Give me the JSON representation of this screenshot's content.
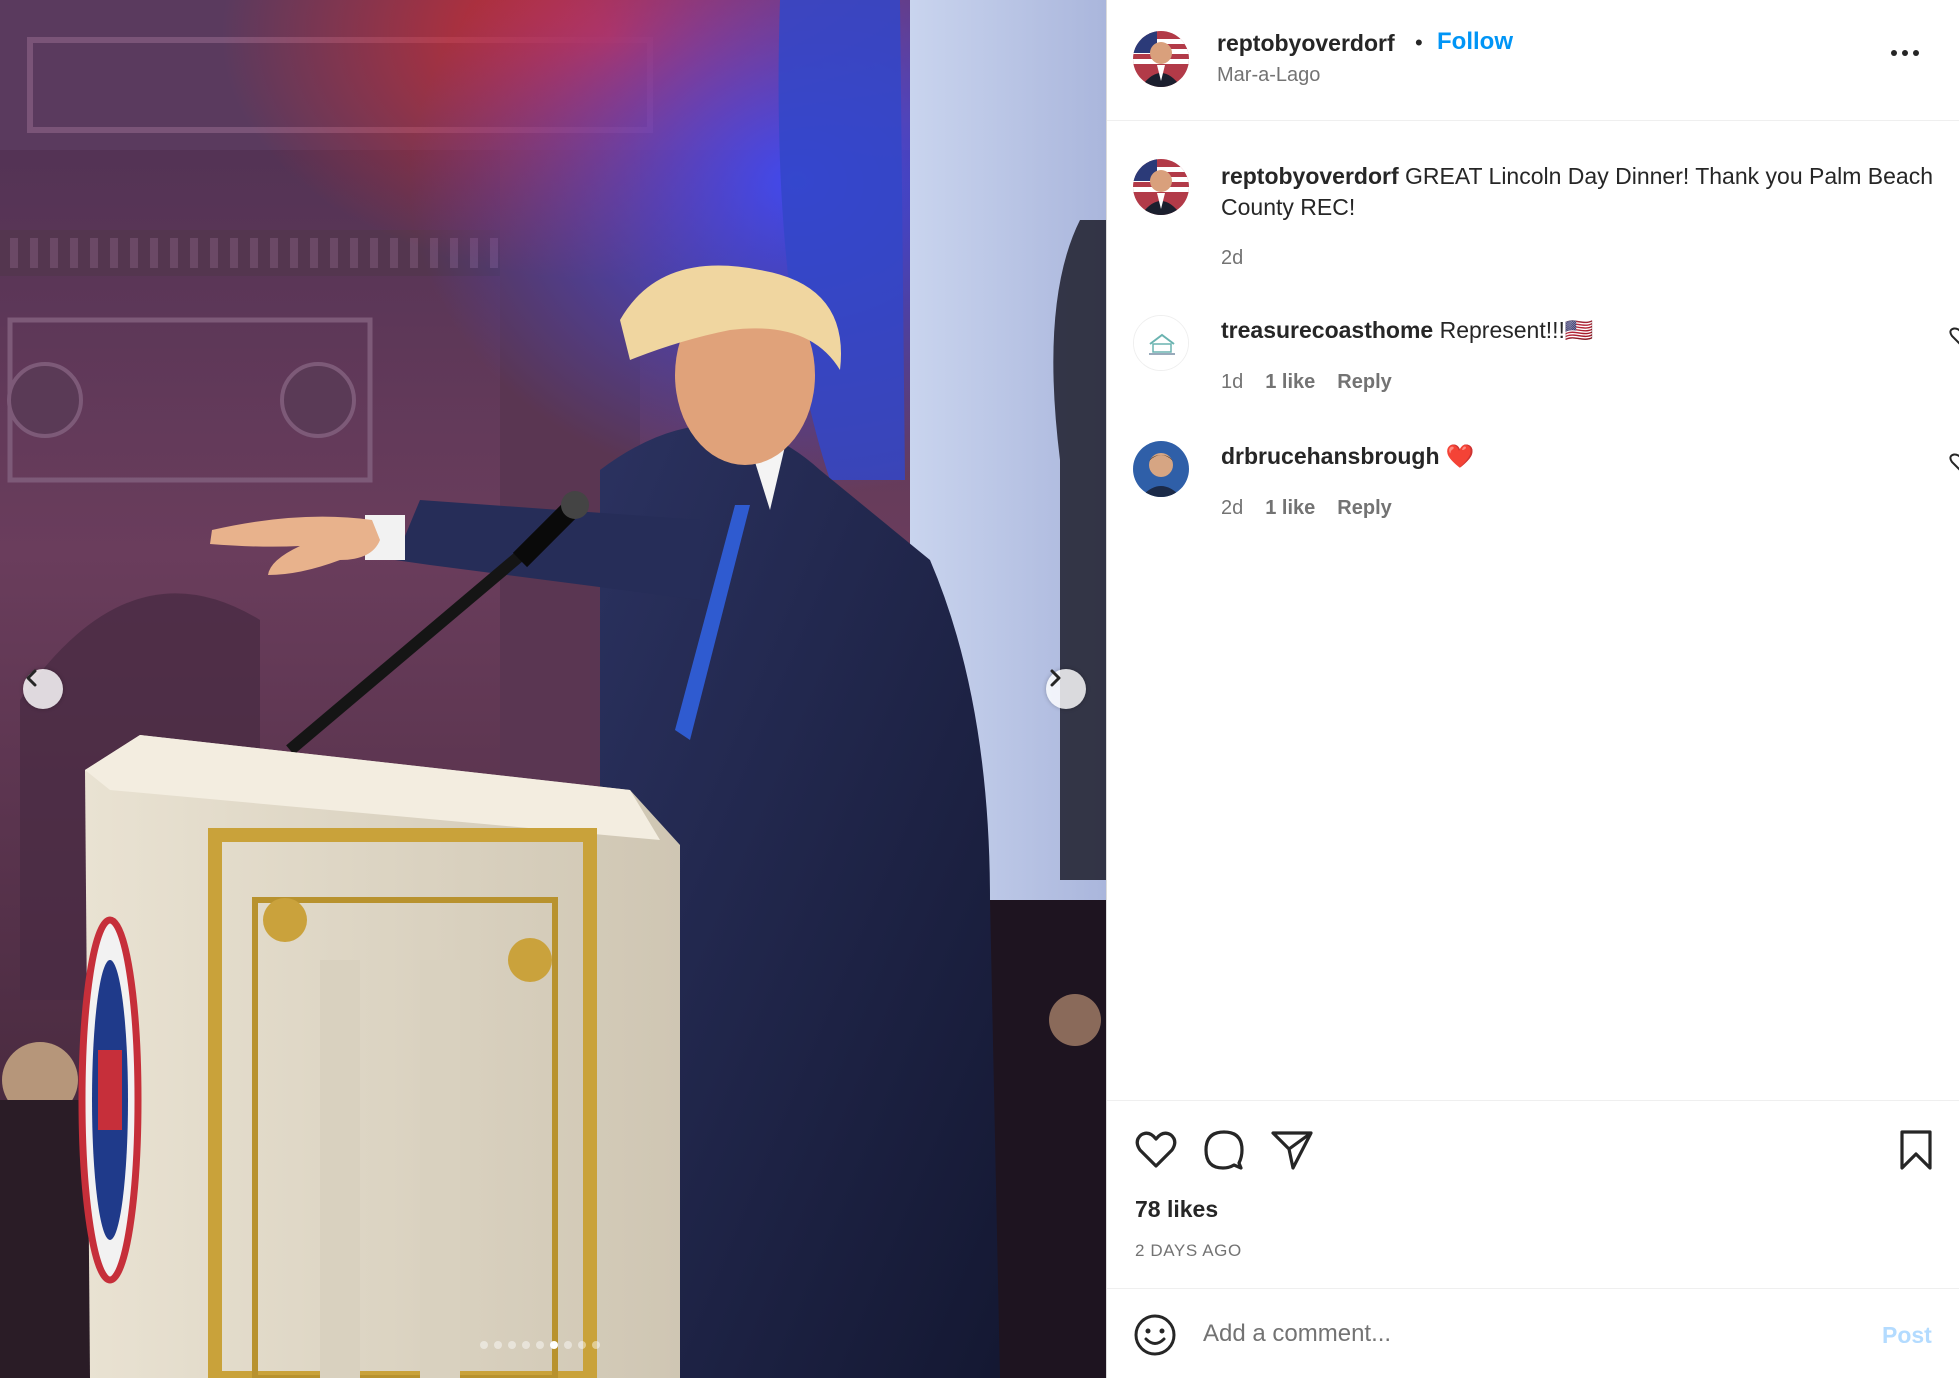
{
  "post": {
    "username": "reptobyoverdorf",
    "separator": "•",
    "follow_label": "Follow",
    "location": "Mar-a-Lago",
    "more_icon": "more-horizontal-icon"
  },
  "caption": {
    "username": "reptobyoverdorf",
    "text": "GREAT Lincoln Day Dinner! Thank you Palm Beach County REC!",
    "time": "2d"
  },
  "comments": [
    {
      "username": "treasurecoasthome",
      "text": "Represent!!!🇺🇸",
      "time": "1d",
      "likes": "1 like",
      "reply_label": "Reply"
    },
    {
      "username": "drbrucehansbrough",
      "text": "❤️",
      "time": "2d",
      "likes": "1 like",
      "reply_label": "Reply"
    }
  ],
  "actions": {
    "like_icon": "heart-icon",
    "comment_icon": "comment-icon",
    "share_icon": "send-icon",
    "save_icon": "bookmark-icon"
  },
  "likes_text": "78 likes",
  "date_text": "2 DAYS AGO",
  "comment_box": {
    "placeholder": "Add a comment...",
    "post_label": "Post"
  },
  "carousel": {
    "slide_count": 9,
    "active_slide": 6
  },
  "colors": {
    "accent": "#0095f6",
    "post_disabled": "#b3dbff",
    "secondary_text": "#737373"
  }
}
